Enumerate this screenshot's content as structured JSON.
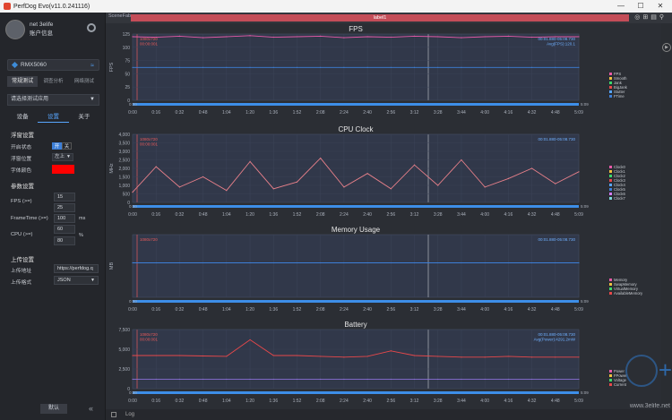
{
  "window": {
    "title": "PerfDog Evo(v11.0.241116)",
    "minimize": "—",
    "maximize": "☐",
    "close": "✕"
  },
  "user": {
    "name": "net 3elife",
    "status": "账户信息"
  },
  "device": {
    "name": "RMX5060"
  },
  "test_tabs": [
    "常规测试",
    "调查分析",
    "网络测试"
  ],
  "app_select": {
    "value": "请选择测试应用"
  },
  "settings_tabs": [
    "设备",
    "设置",
    "关于"
  ],
  "float_settings": {
    "title": "浮窗设置",
    "switch_label": "开启状态",
    "switch_on": "开",
    "switch_off": "关",
    "position_label": "浮窗位置",
    "position_value": "左上",
    "font_color_label": "字体颜色",
    "font_color": "#ff0000"
  },
  "params": {
    "title": "参数设置",
    "fps_label": "FPS (>=)",
    "fps_1": "15",
    "fps_2": "25",
    "frametime_label": "FrameTime (>=)",
    "frametime_value": "100",
    "frametime_unit": "ms",
    "cpu_label": "CPU (>=)",
    "cpu_1": "60",
    "cpu_2": "80",
    "cpu_unit": "%"
  },
  "upload": {
    "title": "上传设置",
    "addr_label": "上传地址",
    "addr_value": "https://perfdog.q",
    "format_label": "上传格式",
    "format_value": "JSON"
  },
  "bottom": {
    "button": "默认",
    "collapse": "«"
  },
  "topbar": {
    "scene": "SceneFab",
    "label": "label1"
  },
  "log": {
    "label": "Log"
  },
  "watermark": {
    "text": "www.3elife.net"
  },
  "time_ticks": [
    "0:00",
    "0:16",
    "0:32",
    "0:48",
    "1:04",
    "1:20",
    "1:36",
    "1:52",
    "2:08",
    "2:24",
    "2:40",
    "2:56",
    "3:12",
    "3:28",
    "3:44",
    "4:00",
    "4:16",
    "4:32",
    "4:48",
    "5:09"
  ],
  "colors": {
    "fps": "#e85aa8",
    "cpu": "#e8808a",
    "memory": "#3d7fd8",
    "battery": "#e8484a",
    "accent": "#3d7fd8",
    "label_bar": "#c44d58"
  },
  "chart_data": [
    {
      "type": "line",
      "title": "FPS",
      "ylabel": "FPS",
      "yticks": [
        "0",
        "25",
        "50",
        "75",
        "100",
        "125"
      ],
      "ylim": [
        0,
        125
      ],
      "range_start": "0:00",
      "range_end": "5:09",
      "left_info": [
        "1080x720",
        "00:00:001"
      ],
      "right_info": [
        "00:01.880-05:08.730",
        "Avg(FPS):120.1"
      ],
      "legend": [
        "FPS",
        "Smooth",
        "Jank",
        "BigJank",
        "Stutter",
        "FTime"
      ],
      "series": [
        {
          "name": "FPS",
          "values": [
            120,
            119,
            121,
            118,
            120,
            122,
            119,
            120,
            121,
            118,
            120,
            119,
            121,
            120,
            118,
            120,
            121,
            119,
            120,
            120
          ]
        },
        {
          "name": "FTime",
          "values": [
            62,
            62,
            62,
            62,
            62,
            62,
            62,
            62,
            62,
            62,
            62,
            62,
            62,
            62,
            62,
            62,
            62,
            62,
            62,
            62
          ]
        }
      ]
    },
    {
      "type": "line",
      "title": "CPU Clock",
      "ylabel": "MHz",
      "yticks": [
        "0",
        "500",
        "1,000",
        "1,500",
        "2,000",
        "2,500",
        "3,000",
        "3,500",
        "4,000"
      ],
      "ylim": [
        0,
        4000
      ],
      "range_start": "0:00",
      "range_end": "5:09",
      "left_info": [
        "1080x720",
        "00:00:001"
      ],
      "right_info": [
        "00:01.880-05:08.730"
      ],
      "legend": [
        "Clock0",
        "Clock1",
        "Clock2",
        "Clock3",
        "Clock4",
        "Clock5",
        "Clock6",
        "Clock7"
      ],
      "series": [
        {
          "name": "Clock",
          "values": [
            600,
            2100,
            900,
            1500,
            700,
            2400,
            800,
            1200,
            2600,
            900,
            1700,
            800,
            2200,
            1000,
            2500,
            900,
            1400,
            2000,
            1100,
            1800
          ]
        }
      ]
    },
    {
      "type": "line",
      "title": "Memory Usage",
      "ylabel": "MB",
      "range_start": "0:00",
      "range_end": "5:09",
      "left_info": [
        "1080x720"
      ],
      "right_info": [
        "00:01.880-05:08.730"
      ],
      "legend": [
        "Memory",
        "SwapMemory",
        "VirtualMemory",
        "AvailableMemory"
      ],
      "series": [
        {
          "name": "Memory",
          "values": [
            2597,
            2597,
            2597,
            2597,
            2597,
            2597,
            2597,
            2597,
            2597,
            2597,
            2597,
            2597,
            2597,
            2597,
            2597,
            2597,
            2597,
            2597,
            2597,
            2597
          ]
        }
      ]
    },
    {
      "type": "line",
      "title": "Battery",
      "ylabel": "",
      "yticks": [
        "0",
        "2,500",
        "5,000",
        "7,500"
      ],
      "ylim": [
        0,
        7500
      ],
      "range_start": "0:00",
      "range_end": "5:09",
      "left_info": [
        "1080x720",
        "00:00:001"
      ],
      "right_info": [
        "00:01.880-05:08.730",
        "Avg(Power):4291.2mW"
      ],
      "legend": [
        "Power",
        "FPower",
        "Voltage",
        "Current"
      ],
      "series": [
        {
          "name": "Power",
          "values": [
            4200,
            4200,
            4200,
            4150,
            4100,
            6200,
            4200,
            4200,
            4100,
            4000,
            4100,
            4800,
            4200,
            4100,
            4000,
            4000,
            4100,
            4000,
            4000,
            4000
          ]
        },
        {
          "name": "Current",
          "values": [
            1200,
            1200,
            1200,
            1200,
            1200,
            1200,
            1200,
            1200,
            1200,
            1200,
            1200,
            1200,
            1200,
            1200,
            1200,
            1200,
            1200,
            1200,
            1200,
            1200
          ]
        }
      ]
    }
  ]
}
